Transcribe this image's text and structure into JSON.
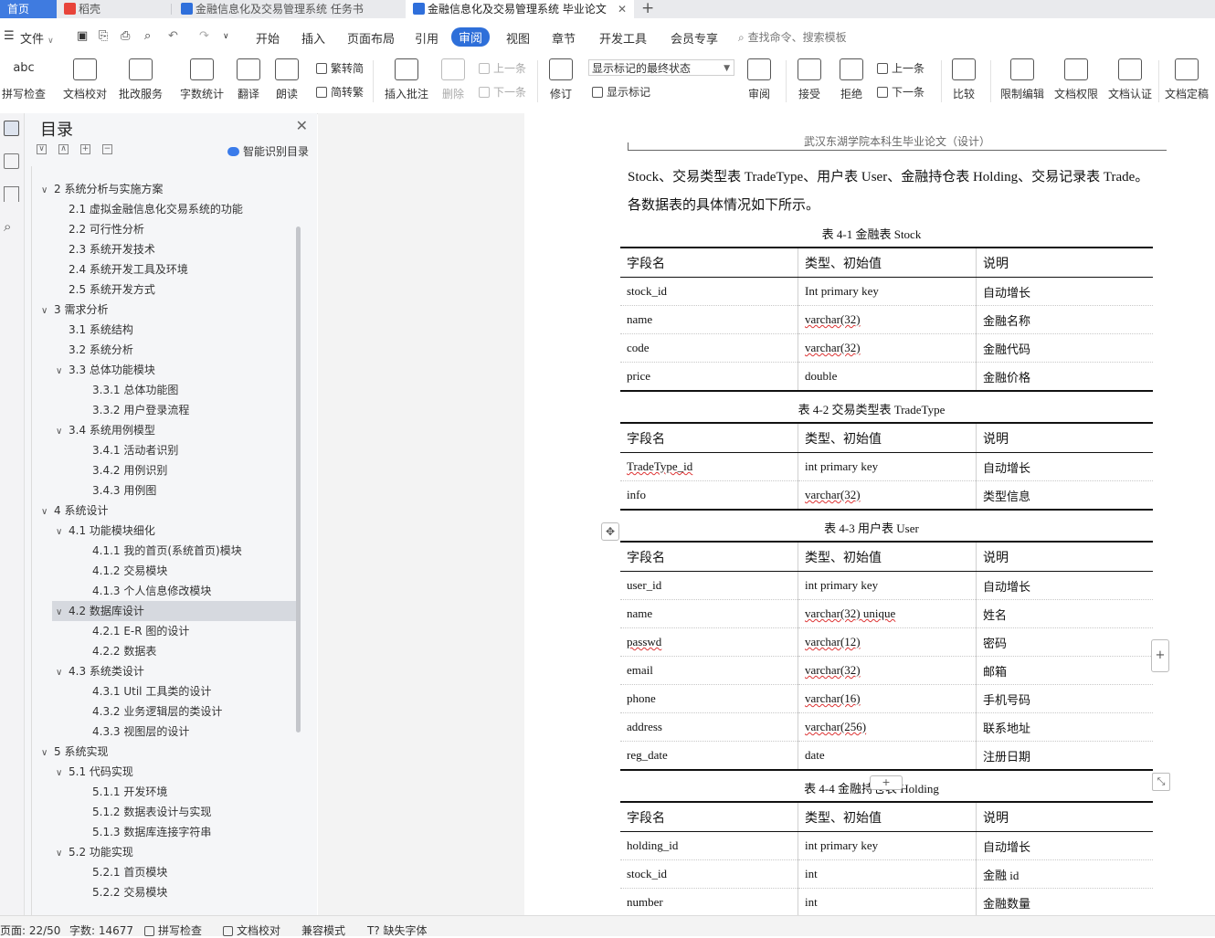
{
  "tabs": {
    "home": "首页",
    "items": [
      {
        "label": "稻壳",
        "color": "#e8443a"
      },
      {
        "label": "金融信息化及交易管理系统 任务书",
        "color": "#2f6fdb"
      },
      {
        "label": "金融信息化及交易管理系统 毕业论文",
        "color": "#2f6fdb"
      }
    ],
    "new_tab": "+",
    "close": "✕"
  },
  "menubar": {
    "file": "文件",
    "items": [
      "开始",
      "插入",
      "页面布局",
      "引用",
      "审阅",
      "视图",
      "章节",
      "开发工具",
      "会员专享"
    ],
    "active": "审阅",
    "search_placeholder": "查找命令、搜索模板"
  },
  "ribbon": {
    "spellcheck": "拼写检查",
    "doc_proof": "文档校对",
    "batch_service": "批改服务",
    "word_count": "字数统计",
    "translate": "翻译",
    "read_aloud": "朗读",
    "to_traditional": "繁转简",
    "to_simplified": "简转繁",
    "insert_comment": "插入批注",
    "delete": "删除",
    "prev_item": "上一条",
    "next_item": "下一条",
    "track_changes": "修订",
    "markup_state": "显示标记的最终状态",
    "show_markup": "显示标记",
    "review": "审阅",
    "accept": "接受",
    "reject": "拒绝",
    "prev_change": "上一条",
    "next_change": "下一条",
    "compare": "比较",
    "restrict_edit": "限制编辑",
    "doc_permission": "文档权限",
    "doc_certify": "文档认证",
    "doc_finalize": "文档定稿"
  },
  "toc": {
    "title": "目录",
    "smart_label": "智能识别目录",
    "items": [
      {
        "text": "2 系统分析与实施方案",
        "level": 1,
        "chevron": "∨"
      },
      {
        "text": "2.1 虚拟金融信息化交易系统的功能",
        "level": 2,
        "chevron": ""
      },
      {
        "text": "2.2 可行性分析",
        "level": 2,
        "chevron": ""
      },
      {
        "text": "2.3 系统开发技术",
        "level": 2,
        "chevron": ""
      },
      {
        "text": "2.4 系统开发工具及环境",
        "level": 2,
        "chevron": ""
      },
      {
        "text": "2.5 系统开发方式",
        "level": 2,
        "chevron": ""
      },
      {
        "text": "3 需求分析",
        "level": 1,
        "chevron": "∨"
      },
      {
        "text": "3.1 系统结构",
        "level": 2,
        "chevron": ""
      },
      {
        "text": "3.2 系统分析",
        "level": 2,
        "chevron": ""
      },
      {
        "text": "3.3 总体功能模块",
        "level": 2,
        "chevron": "∨"
      },
      {
        "text": "3.3.1 总体功能图",
        "level": 3,
        "chevron": ""
      },
      {
        "text": "3.3.2 用户登录流程",
        "level": 3,
        "chevron": ""
      },
      {
        "text": "3.4 系统用例模型",
        "level": 2,
        "chevron": "∨"
      },
      {
        "text": "3.4.1 活动者识别",
        "level": 3,
        "chevron": ""
      },
      {
        "text": "3.4.2 用例识别",
        "level": 3,
        "chevron": ""
      },
      {
        "text": "3.4.3 用例图",
        "level": 3,
        "chevron": ""
      },
      {
        "text": "4 系统设计",
        "level": 1,
        "chevron": "∨"
      },
      {
        "text": "4.1 功能模块细化",
        "level": 2,
        "chevron": "∨"
      },
      {
        "text": "4.1.1 我的首页(系统首页)模块",
        "level": 3,
        "chevron": ""
      },
      {
        "text": "4.1.2 交易模块",
        "level": 3,
        "chevron": ""
      },
      {
        "text": "4.1.3 个人信息修改模块",
        "level": 3,
        "chevron": ""
      },
      {
        "text": "4.2 数据库设计",
        "level": 2,
        "chevron": "∨"
      },
      {
        "text": "4.2.1 E-R 图的设计",
        "level": 3,
        "chevron": ""
      },
      {
        "text": "4.2.2 数据表",
        "level": 3,
        "chevron": ""
      },
      {
        "text": "4.3 系统类设计",
        "level": 2,
        "chevron": "∨"
      },
      {
        "text": "4.3.1 Util 工具类的设计",
        "level": 3,
        "chevron": ""
      },
      {
        "text": "4.3.2 业务逻辑层的类设计",
        "level": 3,
        "chevron": ""
      },
      {
        "text": "4.3.3 视图层的设计",
        "level": 3,
        "chevron": ""
      },
      {
        "text": "5 系统实现",
        "level": 1,
        "chevron": "∨"
      },
      {
        "text": "5.1 代码实现",
        "level": 2,
        "chevron": "∨"
      },
      {
        "text": "5.1.1 开发环境",
        "level": 3,
        "chevron": ""
      },
      {
        "text": "5.1.2 数据表设计与实现",
        "level": 3,
        "chevron": ""
      },
      {
        "text": "5.1.3 数据库连接字符串",
        "level": 3,
        "chevron": ""
      },
      {
        "text": "5.2 功能实现",
        "level": 2,
        "chevron": "∨"
      },
      {
        "text": "5.2.1 首页模块",
        "level": 3,
        "chevron": ""
      },
      {
        "text": "5.2.2 交易模块",
        "level": 3,
        "chevron": ""
      }
    ],
    "selected_index": 21
  },
  "document": {
    "header": "武汉东湖学院本科生毕业论文（设计）",
    "para_lines": [
      "Stock、交易类型表 TradeType、用户表 User、金融持仓表 Holding、交易记录表 Trade。",
      "各数据表的具体情况如下所示。"
    ],
    "tables": [
      {
        "caption": "表 4-1 金融表 Stock",
        "header": [
          "字段名",
          "类型、初始值",
          "说明"
        ],
        "rows": [
          [
            "stock_id",
            "Int primary key",
            "自动增长"
          ],
          [
            "name",
            "varchar(32)",
            "金融名称"
          ],
          [
            "code",
            "varchar(32)",
            "金融代码"
          ],
          [
            "price",
            "double",
            "金融价格"
          ]
        ]
      },
      {
        "caption": "表 4-2 交易类型表 TradeType",
        "header": [
          "字段名",
          "类型、初始值",
          "说明"
        ],
        "rows": [
          [
            "TradeType_id",
            "int primary key",
            "自动增长"
          ],
          [
            "info",
            "varchar(32)",
            "类型信息"
          ]
        ]
      },
      {
        "caption": "表 4-3  用户表 User",
        "header": [
          "字段名",
          "类型、初始值",
          "说明"
        ],
        "rows": [
          [
            "user_id",
            "int primary key",
            "自动增长"
          ],
          [
            "name",
            "varchar(32)    unique",
            "姓名"
          ],
          [
            "passwd",
            "varchar(12)",
            "密码"
          ],
          [
            "email",
            "varchar(32)",
            "邮箱"
          ],
          [
            "phone",
            "varchar(16)",
            "手机号码"
          ],
          [
            "address",
            "varchar(256)",
            "联系地址"
          ],
          [
            "reg_date",
            "date",
            "注册日期"
          ]
        ]
      },
      {
        "caption": "表 4-4  金融持仓表 Holding",
        "header": [
          "字段名",
          "类型、初始值",
          "说明"
        ],
        "rows": [
          [
            "holding_id",
            "int primary key",
            "自动增长"
          ],
          [
            "stock_id",
            "int",
            "金融 id"
          ],
          [
            "number",
            "int",
            "金融数量"
          ]
        ]
      }
    ]
  },
  "statusbar": {
    "page": "页面: 22/50",
    "word_count": "字数: 14677",
    "spellcheck": "拼写检查",
    "doc_proof": "文档校对",
    "compat_mode": "兼容模式",
    "missing_font": "缺失字体"
  }
}
